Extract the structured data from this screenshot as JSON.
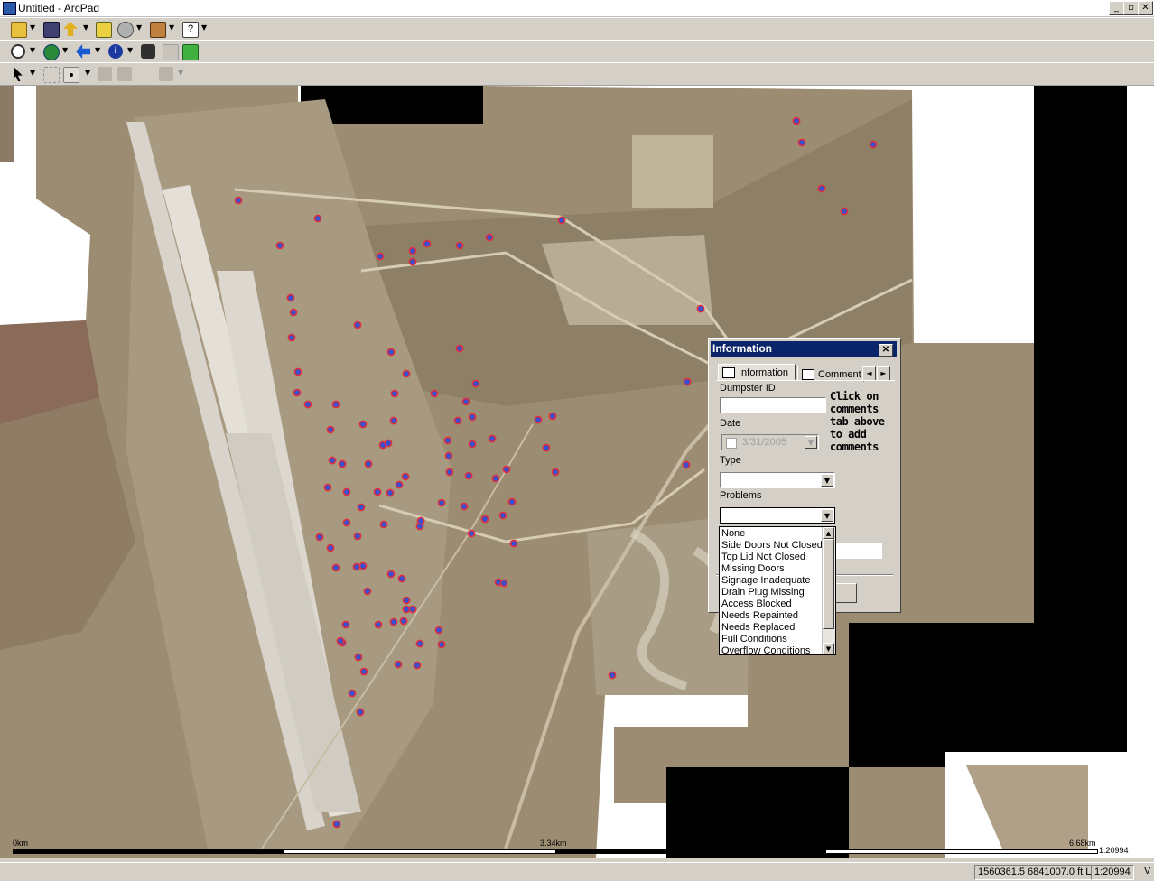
{
  "window": {
    "title": "Untitled - ArcPad",
    "min": "_",
    "max": "▫",
    "close": "✕"
  },
  "colors": {
    "dialog_title": "#0a246a",
    "point_fill": "#3a4fcf",
    "point_ring": "#e0303a",
    "aerial_ground": "#9a8a70"
  },
  "toolbars": {
    "row1": [
      "open-icon",
      "save-icon",
      "add-layer-icon",
      "layers-icon",
      "gps-icon",
      "tools-icon",
      "help-icon"
    ],
    "row2": [
      "zoom-in-icon",
      "globe-icon",
      "back-arrow-icon",
      "identify-icon",
      "find-icon",
      "disabled-tool-icon",
      "refresh-icon"
    ],
    "row3": [
      "pointer-icon",
      "select-area-icon",
      "point-icon",
      "edit-vertex-icon",
      "move-icon",
      "properties-icon"
    ]
  },
  "dialog": {
    "title": "Information",
    "close": "✕",
    "tabs": [
      "Information",
      "Comment"
    ],
    "tab_prev": "◄",
    "tab_next": "►",
    "fields": {
      "dumpster_id_label": "Dumpster ID",
      "dumpster_id_value": "",
      "date_label": "Date",
      "date_value": "3/31/2005",
      "type_label": "Type",
      "type_value": "",
      "problems_label": "Problems",
      "problems_value": ""
    },
    "note": "Click on comments tab above to add comments"
  },
  "problems_options": [
    "None",
    "Side Doors Not Closed",
    "Top Lid Not Closed",
    "Missing Doors",
    "Signage Inadequate",
    "Drain Plug Missing",
    "Access Blocked",
    "Needs Repainted",
    "Needs Replaced",
    "Full Conditions",
    "Overflow Conditions"
  ],
  "scale": {
    "start": "0km",
    "mid": "3.34km",
    "end": "6.68km",
    "ratio": "1:20994"
  },
  "status": {
    "coords": "1560361.5 6841007.0 ft L",
    "scale": "1:20994",
    "extra": "V"
  }
}
